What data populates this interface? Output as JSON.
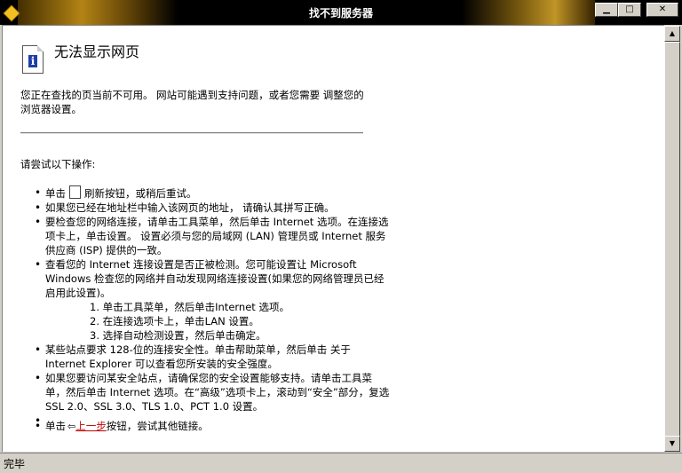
{
  "window": {
    "title": "找不到服务器",
    "minimize": "▁",
    "maximize": "□",
    "close": "✕"
  },
  "page": {
    "heading": "无法显示网页",
    "intro": "您正在查找的页当前不可用。 网站可能遇到支持问题，或者您需要 调整您的浏览器设置。",
    "try_label": "请尝试以下操作:",
    "items": {
      "refresh_pre": "单击",
      "refresh_post": "刷新按钮，或稍后重试。",
      "address": "如果您已经在地址栏中输入该网页的地址， 请确认其拼写正确。",
      "network": "要检查您的网络连接，请单击工具菜单，然后单击 Internet 选项。在连接选项卡上，单击设置。 设置必须与您的局域网 (LAN) 管理员或 Internet 服务供应商 (ISP) 提供的一致。",
      "detect": "查看您的 Internet 连接设置是否正被检测。您可能设置让 Microsoft Windows 检查您的网络并自动发现网络连接设置(如果您的网络管理员已经启用此设置)。",
      "step1": "1.  单击工具菜单，然后单击Internet 选项。",
      "step2": "2.  在连接选项卡上，单击LAN 设置。",
      "step3": "3.  选择自动检测设置，然后单击确定。",
      "ssl": "某些站点要求 128-位的连接安全性。单击帮助菜单，然后单击 关于 Internet Explorer 可以查看您所安装的安全强度。",
      "secure": "如果您要访问某安全站点，请确保您的安全设置能够支持。请单击工具菜单，然后单击 Internet 选项。在“高级”选项卡上，滚动到“安全”部分，复选 SSL 2.0、SSL 3.0、TLS 1.0、PCT 1.0 设置。",
      "back_pre": "单击",
      "back_link": "上一步",
      "back_post": "按钮，尝试其他链接。"
    }
  },
  "status": {
    "text": "完毕"
  }
}
